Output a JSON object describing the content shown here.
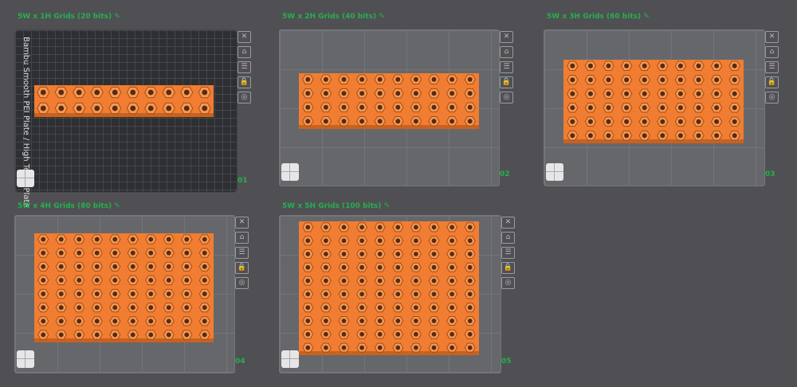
{
  "colors": {
    "accent": "#22b24c",
    "object": "#f07d32",
    "hole": "#5a2a0e"
  },
  "plate_label": "Bambu Smooth PEI Plate / High Temp Plate",
  "plates": [
    {
      "title": "5W x 1H Grids (20 bits) ✎",
      "number": "01",
      "rows": 2,
      "cols": 10
    },
    {
      "title": "5W x 2H Grids (40 bits) ✎",
      "number": "02",
      "rows": 4,
      "cols": 10
    },
    {
      "title": "5W x 3H Grids (60 bits) ✎",
      "number": "03",
      "rows": 6,
      "cols": 10
    },
    {
      "title": "5W x 4H Grids (80 bits) ✎",
      "number": "04",
      "rows": 8,
      "cols": 10
    },
    {
      "title": "5W x 5H Grids (100 bits) ✎",
      "number": "05",
      "rows": 10,
      "cols": 10
    }
  ],
  "tool_icons": [
    "close-icon",
    "arrange-icon",
    "layout-icon",
    "lock-icon",
    "eye-icon"
  ]
}
